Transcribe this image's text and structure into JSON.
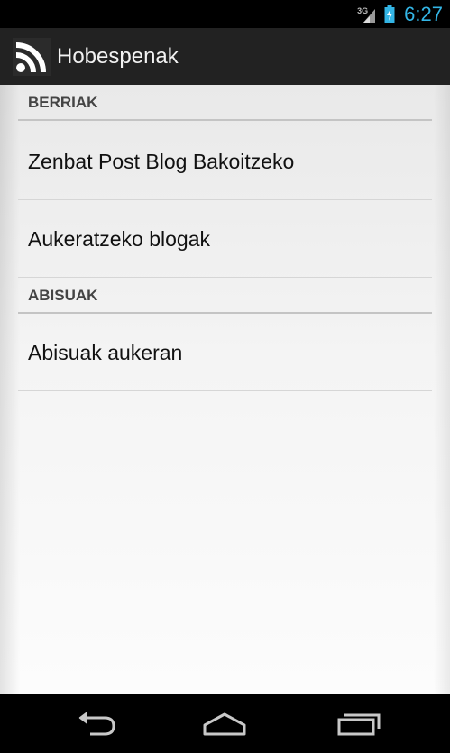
{
  "status_bar": {
    "network_type": "3G",
    "time": "6:27",
    "icons": [
      "signal-icon",
      "battery-charging-icon"
    ]
  },
  "action_bar": {
    "title": "Hobespenak",
    "icon": "rss-feed-icon"
  },
  "preferences": {
    "sections": [
      {
        "header": "BERRIAK",
        "items": [
          {
            "label": "Zenbat Post Blog Bakoitzeko"
          },
          {
            "label": "Aukeratzeko blogak"
          }
        ]
      },
      {
        "header": "ABISUAK",
        "items": [
          {
            "label": "Abisuak aukeran"
          }
        ]
      }
    ]
  },
  "nav_bar": {
    "buttons": [
      "back-icon",
      "home-icon",
      "recent-apps-icon"
    ]
  },
  "colors": {
    "accent": "#33b5e5",
    "action_bar": "#222222"
  }
}
